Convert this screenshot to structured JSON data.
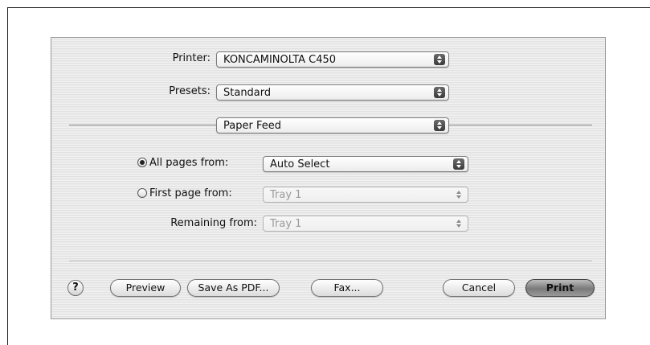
{
  "printer": {
    "label": "Printer:",
    "value": "KONCAMINOLTA C450"
  },
  "presets": {
    "label": "Presets:",
    "value": "Standard"
  },
  "panel": {
    "value": "Paper Feed"
  },
  "paper_feed": {
    "all_pages": {
      "label": "All pages from:",
      "value": "Auto Select",
      "selected": true
    },
    "first_page": {
      "label": "First page from:",
      "value": "Tray 1",
      "selected": false
    },
    "remaining": {
      "label": "Remaining from:",
      "value": "Tray 1"
    }
  },
  "buttons": {
    "help": "?",
    "preview": "Preview",
    "save_pdf": "Save As PDF...",
    "fax": "Fax...",
    "cancel": "Cancel",
    "print": "Print"
  }
}
